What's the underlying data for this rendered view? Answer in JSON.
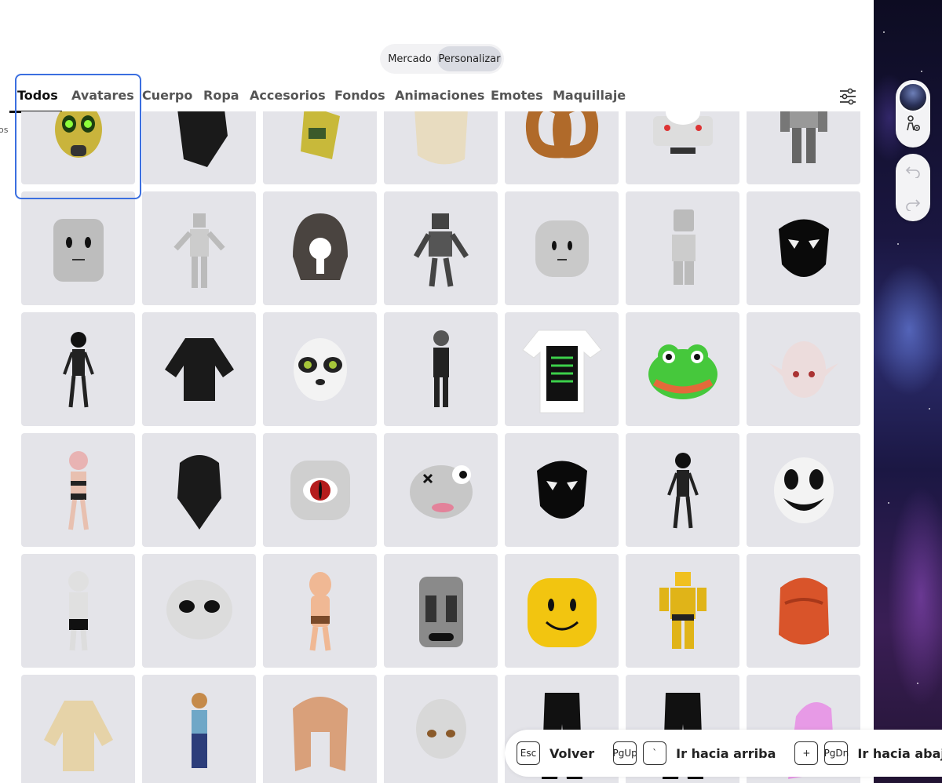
{
  "segment": {
    "mercado": "Mercado",
    "personalizar": "Personalizar",
    "selected": "Personalizar"
  },
  "tabs": [
    "Todos",
    "Avatares",
    "Cuerpo",
    "Ropa",
    "Accesorios",
    "Fondos",
    "Animaciones",
    "Emotes",
    "Maquillaje"
  ],
  "active_tab": "Todos",
  "cut_label": "os",
  "side_toolbar": {
    "icons": [
      "avatar-icon",
      "avatar-settings-icon",
      "undo-icon",
      "redo-icon"
    ]
  },
  "grid": {
    "items": [
      "green-eyed-mask",
      "black-armor",
      "tag-accessory",
      "blonde-hair",
      "pretzel",
      "cat-car",
      "robot-body",
      "wooden-head",
      "gray-body",
      "rock-helmet",
      "robot-skeleton",
      "classic-head",
      "gray-blocky-body",
      "black-mask",
      "black-skeleton",
      "black-sweater",
      "panda-mask",
      "black-gray-body",
      "death-shirt",
      "frog-face",
      "elf-head",
      "pink-elf-body",
      "black-ponytail",
      "red-eye-head",
      "stitched-head",
      "black-mask",
      "black-skeleton",
      "smile-mask",
      "white-grin-body",
      "alien-head",
      "tan-body",
      "stone-head",
      "classic-smile-head",
      "yellow-blocky-body",
      "red-braided-hair",
      "beige-sweater",
      "girl-avatar",
      "brown-hair",
      "anime-face",
      "black-pants",
      "black-pants",
      "pink-hair"
    ]
  },
  "hints": [
    {
      "keys": [
        "Esc"
      ],
      "label": "Volver"
    },
    {
      "keys": [
        "PgUp",
        "`"
      ],
      "label": "Ir hacia arriba"
    },
    {
      "keys": [
        "+",
        "PgDn"
      ],
      "label": "Ir hacia abajo"
    }
  ],
  "colors": {
    "focus_ring": "#3b6fe0",
    "tile_bg": "#e4e4e9",
    "selected_segment": "#d9dbe2"
  }
}
